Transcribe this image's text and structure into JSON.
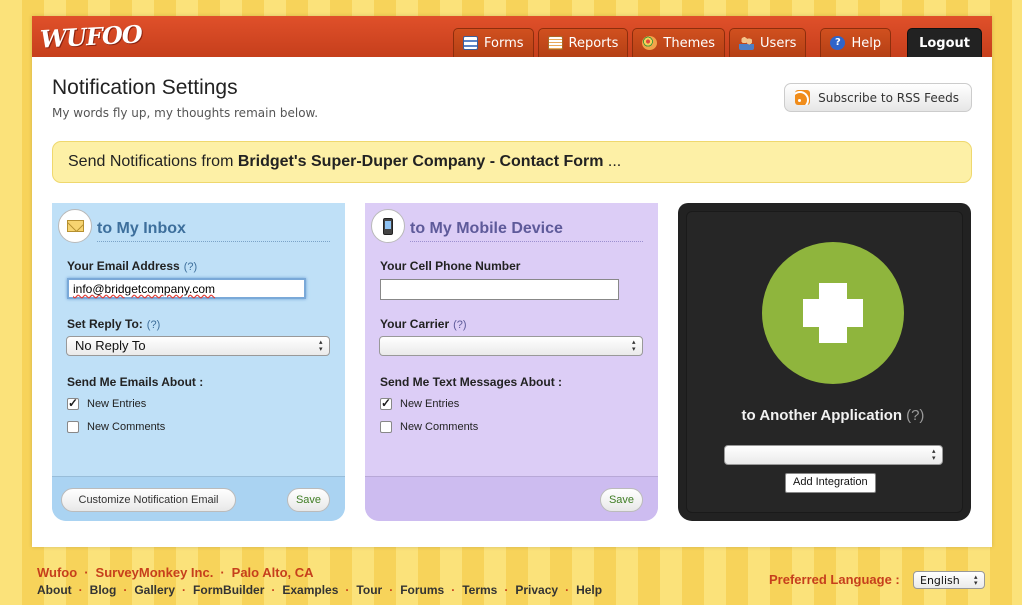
{
  "header": {
    "logo": "WUFOO",
    "nav": [
      {
        "label": "Forms",
        "icon": "forms-icon"
      },
      {
        "label": "Reports",
        "icon": "reports-icon"
      },
      {
        "label": "Themes",
        "icon": "themes-icon"
      },
      {
        "label": "Users",
        "icon": "users-icon"
      },
      {
        "label": "Help",
        "icon": "help-icon"
      },
      {
        "label": "Logout"
      }
    ]
  },
  "page": {
    "title": "Notification Settings",
    "subtitle": "My words fly up, my thoughts remain below.",
    "rss_button": "Subscribe to RSS Feeds"
  },
  "banner": {
    "prefix": "Send Notifications from ",
    "form_name": "Bridget's Super-Duper Company - Contact Form",
    "ellipsis": " ..."
  },
  "inbox": {
    "title": "to My Inbox",
    "email_label": "Your Email Address",
    "help": "(?)",
    "email_value": "info@bridgetcompany.com",
    "reply_label": "Set Reply To:",
    "reply_value": "No Reply To",
    "about_label": "Send Me Emails About :",
    "option_entries": "New Entries",
    "option_comments": "New Comments",
    "customize_button": "Customize Notification Email",
    "save_button": "Save"
  },
  "mobile": {
    "title": "to My Mobile Device",
    "phone_label": "Your Cell Phone Number",
    "phone_value": "",
    "carrier_label": "Your Carrier",
    "help": "(?)",
    "carrier_value": "",
    "about_label": "Send Me Text Messages About :",
    "option_entries": "New Entries",
    "option_comments": "New Comments",
    "save_button": "Save"
  },
  "integration": {
    "title": "to Another Application",
    "help": "(?)",
    "select_value": "",
    "add_button": "Add Integration"
  },
  "footer": {
    "line1": [
      "Wufoo",
      "SurveyMonkey Inc.",
      "Palo Alto, CA"
    ],
    "links": [
      "About",
      "Blog",
      "Gallery",
      "FormBuilder",
      "Examples",
      "Tour",
      "Forums",
      "Terms",
      "Privacy",
      "Help"
    ],
    "language_label": "Preferred Language :",
    "language_value": "English"
  },
  "colors": {
    "header_red": "#c63f1c",
    "inbox_blue": "#bfe0f7",
    "mobile_purple": "#dccdf6",
    "plus_green": "#8fb53d",
    "banner_yellow": "#fdf0a6"
  }
}
